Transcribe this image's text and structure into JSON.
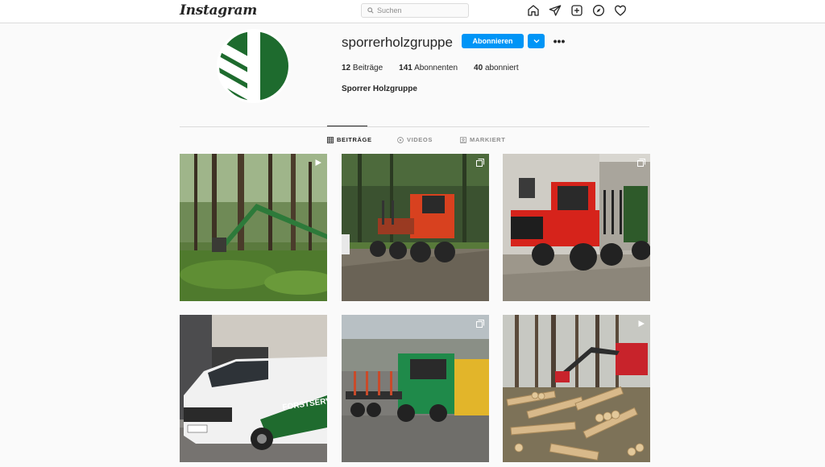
{
  "nav": {
    "logo": "Instagram",
    "search_placeholder": "Suchen",
    "icons": [
      "home-icon",
      "direct-icon",
      "new-post-icon",
      "explore-icon",
      "activity-heart-icon"
    ]
  },
  "profile": {
    "username": "sporrerholzgruppe",
    "follow_label": "Abonnieren",
    "more_label": "•••",
    "stats": [
      {
        "count": "12",
        "label": "Beiträge"
      },
      {
        "count": "141",
        "label": "Abonnenten"
      },
      {
        "count": "40",
        "label": "abonniert"
      }
    ],
    "full_name": "Sporrer Holzgruppe",
    "brand_color": "#1e6b2e"
  },
  "tabs": [
    {
      "label": "BEITRÄGE",
      "active": true,
      "icon": "grid-icon"
    },
    {
      "label": "VIDEOS",
      "active": false,
      "icon": "video-icon"
    },
    {
      "label": "MARKIERT",
      "active": false,
      "icon": "tagged-icon"
    }
  ],
  "posts": [
    {
      "subject": "harvester crane in forest",
      "badge": "video-icon"
    },
    {
      "subject": "red forwarder on forest road",
      "badge": "carousel-icon"
    },
    {
      "subject": "red forwarder at building",
      "badge": "carousel-icon"
    },
    {
      "subject": "white company van",
      "badge": "none",
      "van_text": "FORSTSERVI"
    },
    {
      "subject": "green timber truck",
      "badge": "carousel-icon"
    },
    {
      "subject": "harvester with log piles",
      "badge": "video-icon"
    }
  ]
}
